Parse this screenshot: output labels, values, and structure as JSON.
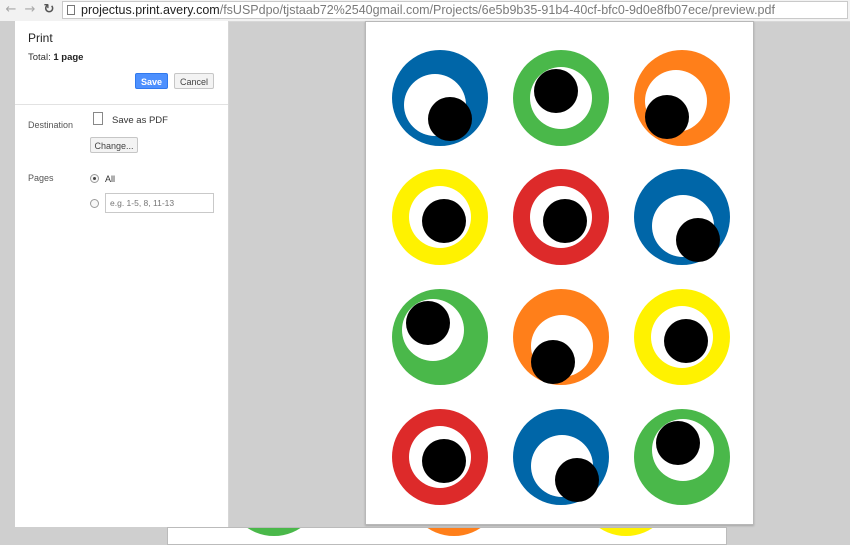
{
  "browser": {
    "url_host": "projectus.print.avery.com",
    "url_path": "/fsUSPdpo/tjstaab72%2540gmail.com/Projects/6e5b9b35-91b4-40cf-bfc0-9d0e8fb07ece/preview.pdf",
    "back_icon": "arrow-left-icon",
    "forward_icon": "arrow-right-icon",
    "reload_icon": "reload-icon"
  },
  "print": {
    "title": "Print",
    "total_prefix": "Total: ",
    "total_value": "1 page",
    "save_label": "Save",
    "cancel_label": "Cancel",
    "destination_label": "Destination",
    "destination_value": "Save as PDF",
    "change_label": "Change...",
    "pages_label": "Pages",
    "pages_all_label": "All",
    "pages_all_selected": true,
    "pages_range_placeholder": "e.g. 1-5, 8, 11-13"
  },
  "colors": {
    "blue": "#0066a8",
    "green": "#4ab84a",
    "orange": "#ff7f1a",
    "yellow": "#fff200",
    "red": "#dd2a2a",
    "save_button": "#4d90fe"
  },
  "preview": {
    "eyes": [
      {
        "color": "blue",
        "white_offset": "down-left",
        "pupil": "down-right"
      },
      {
        "color": "green",
        "white_offset": "center",
        "pupil": "up-left"
      },
      {
        "color": "orange",
        "white_offset": "left",
        "pupil": "down-left"
      },
      {
        "color": "yellow",
        "white_offset": "center",
        "pupil": "center"
      },
      {
        "color": "red",
        "white_offset": "center",
        "pupil": "center"
      },
      {
        "color": "blue",
        "white_offset": "down",
        "pupil": "down-right"
      },
      {
        "color": "green",
        "white_offset": "up-left",
        "pupil": "up-left"
      },
      {
        "color": "orange",
        "white_offset": "down",
        "pupil": "down-left"
      },
      {
        "color": "yellow",
        "white_offset": "center",
        "pupil": "center"
      },
      {
        "color": "red",
        "white_offset": "center",
        "pupil": "center"
      },
      {
        "color": "blue",
        "white_offset": "down",
        "pupil": "down-right"
      },
      {
        "color": "green",
        "white_offset": "up",
        "pupil": "up-left"
      }
    ],
    "next_page_peek": [
      "green",
      "orange",
      "yellow"
    ]
  }
}
